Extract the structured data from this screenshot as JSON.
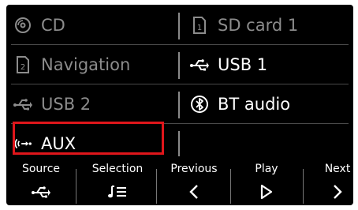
{
  "source_menu": {
    "rows": [
      {
        "left": {
          "label": "CD",
          "icon": "cd-icon",
          "state": "disabled"
        },
        "right": {
          "label": "SD card 1",
          "icon": "sd-card-icon",
          "state": "disabled"
        }
      },
      {
        "left": {
          "label": "Navigation",
          "icon": "navigation-card-icon",
          "state": "disabled"
        },
        "right": {
          "label": "USB 1",
          "icon": "usb-icon",
          "state": "enabled"
        }
      },
      {
        "left": {
          "label": "USB 2",
          "icon": "usb-icon",
          "state": "disabled"
        },
        "right": {
          "label": "BT audio",
          "icon": "bluetooth-icon",
          "state": "enabled"
        }
      },
      {
        "left": {
          "label": "AUX",
          "icon": "aux-icon",
          "state": "enabled",
          "highlighted": true
        },
        "right": {
          "label": "",
          "icon": "",
          "state": "empty"
        }
      }
    ],
    "highlight_color": "#e0161b"
  },
  "bottom_bar": {
    "buttons": [
      {
        "label": "Source",
        "icon": "usb-icon"
      },
      {
        "label": "Selection",
        "icon": "playlist-icon"
      },
      {
        "label": "Previous",
        "icon": "chevron-left-icon"
      },
      {
        "label": "Play",
        "icon": "play-icon"
      },
      {
        "label": "Next",
        "icon": "chevron-right-icon"
      }
    ]
  }
}
